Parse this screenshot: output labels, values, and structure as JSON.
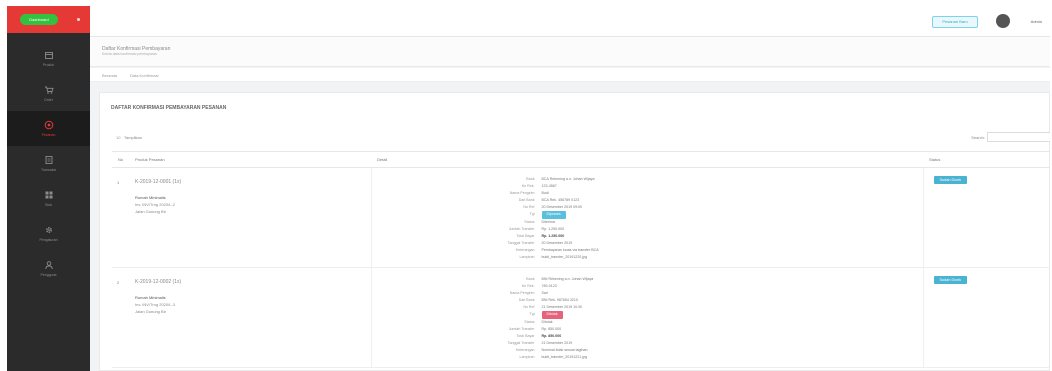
{
  "brand": {
    "label": "Dashboard"
  },
  "sidebar": {
    "items": [
      {
        "label": "Produk",
        "icon": "box-icon"
      },
      {
        "label": "Order",
        "icon": "cart-icon"
      },
      {
        "label": "Pesanan",
        "icon": "clipboard-icon"
      },
      {
        "label": "Transaksi",
        "icon": "receipt-icon"
      },
      {
        "label": "Stok",
        "icon": "grid-icon"
      },
      {
        "label": "Pengaturan",
        "icon": "gear-icon"
      },
      {
        "label": "Pengguna",
        "icon": "user-icon"
      }
    ],
    "active_index": 2
  },
  "header": {
    "action_label": "Pesanan Baru",
    "user_name": "Admin"
  },
  "pagehead": {
    "title": "Daftar Konfirmasi Pembayaran",
    "subtitle": "Kelola data konfirmasi pembayaran"
  },
  "breadcrumb": {
    "home": "Beranda",
    "current": "Data Konfirmasi"
  },
  "panel": {
    "title": "DAFTAR KONFIRMASI PEMBAYARAN PESANAN",
    "show_label": "10",
    "entries_label": "Tampilkan",
    "search_label": "Search:",
    "columns": [
      "No",
      "Produk Pesanan",
      "Detail",
      "Status"
    ]
  },
  "rows": [
    {
      "no": "1",
      "product_name": "K-2019-12-0001 (1x)",
      "lines": [
        "Rumah Minimalis",
        "Inv. INV/Trng 2020/L-2",
        "Jalan Gunung Bir"
      ],
      "details": [
        {
          "k": "Bank",
          "v": "BCA Rekening a.n. Johan Wijaya"
        },
        {
          "k": "Ke Rek.",
          "v": "123-4567"
        },
        {
          "k": "Nama Pengirim",
          "v": "Budi"
        },
        {
          "k": "Dari Bank",
          "v": "BCA Rek. 456789 0123"
        },
        {
          "k": "No Ref",
          "v": "20 Desember 2019 09:00"
        },
        {
          "k": "Tgl",
          "v": "Diproses",
          "tag": "info"
        },
        {
          "k": "Status",
          "v": "Diterima"
        },
        {
          "k": "Jumlah Transfer",
          "v": "Rp. 1.250.000"
        },
        {
          "k": "Total Bayar",
          "v": "Rp. 1.250.000",
          "bold": true
        },
        {
          "k": "Tanggal Transfer",
          "v": "20 Desember 2019"
        },
        {
          "k": "Keterangan",
          "v": "Pembayaran lunas via transfer BCA"
        },
        {
          "k": "Lampiran",
          "v": "bukti_transfer_20191220.jpg"
        }
      ],
      "status": "Sudah Dicek"
    },
    {
      "no": "2",
      "product_name": "K-2019-12-0002 (1x)",
      "lines": [
        "Rumah Minimalis",
        "Inv. INV/Trng 2020/L-3",
        "Jalan Gunung Bir"
      ],
      "details": [
        {
          "k": "Bank",
          "v": "BNI Rekening a.n. Johan Wijaya"
        },
        {
          "k": "Ke Rek.",
          "v": "789-0123"
        },
        {
          "k": "Nama Pengirim",
          "v": "Sari"
        },
        {
          "k": "Dari Bank",
          "v": "BNI Rek. 987654 3210"
        },
        {
          "k": "No Ref",
          "v": "21 Desember 2019 10:30"
        },
        {
          "k": "Tgl",
          "v": "Ditolak",
          "tag": "danger"
        },
        {
          "k": "Status",
          "v": "Ditolak"
        },
        {
          "k": "Jumlah Transfer",
          "v": "Rp. 850.000"
        },
        {
          "k": "Total Bayar",
          "v": "Rp. 850.000",
          "bold": true
        },
        {
          "k": "Tanggal Transfer",
          "v": "21 Desember 2019"
        },
        {
          "k": "Keterangan",
          "v": "Nominal tidak sesuai tagihan"
        },
        {
          "k": "Lampiran",
          "v": "bukti_transfer_20191221.jpg"
        }
      ],
      "status": "Sudah Dicek"
    }
  ],
  "colors": {
    "brand_red": "#e53935",
    "brand_green": "#34c13f",
    "sidebar_bg": "#2b2b2b",
    "info": "#5bc0de",
    "danger": "#e5647b"
  }
}
